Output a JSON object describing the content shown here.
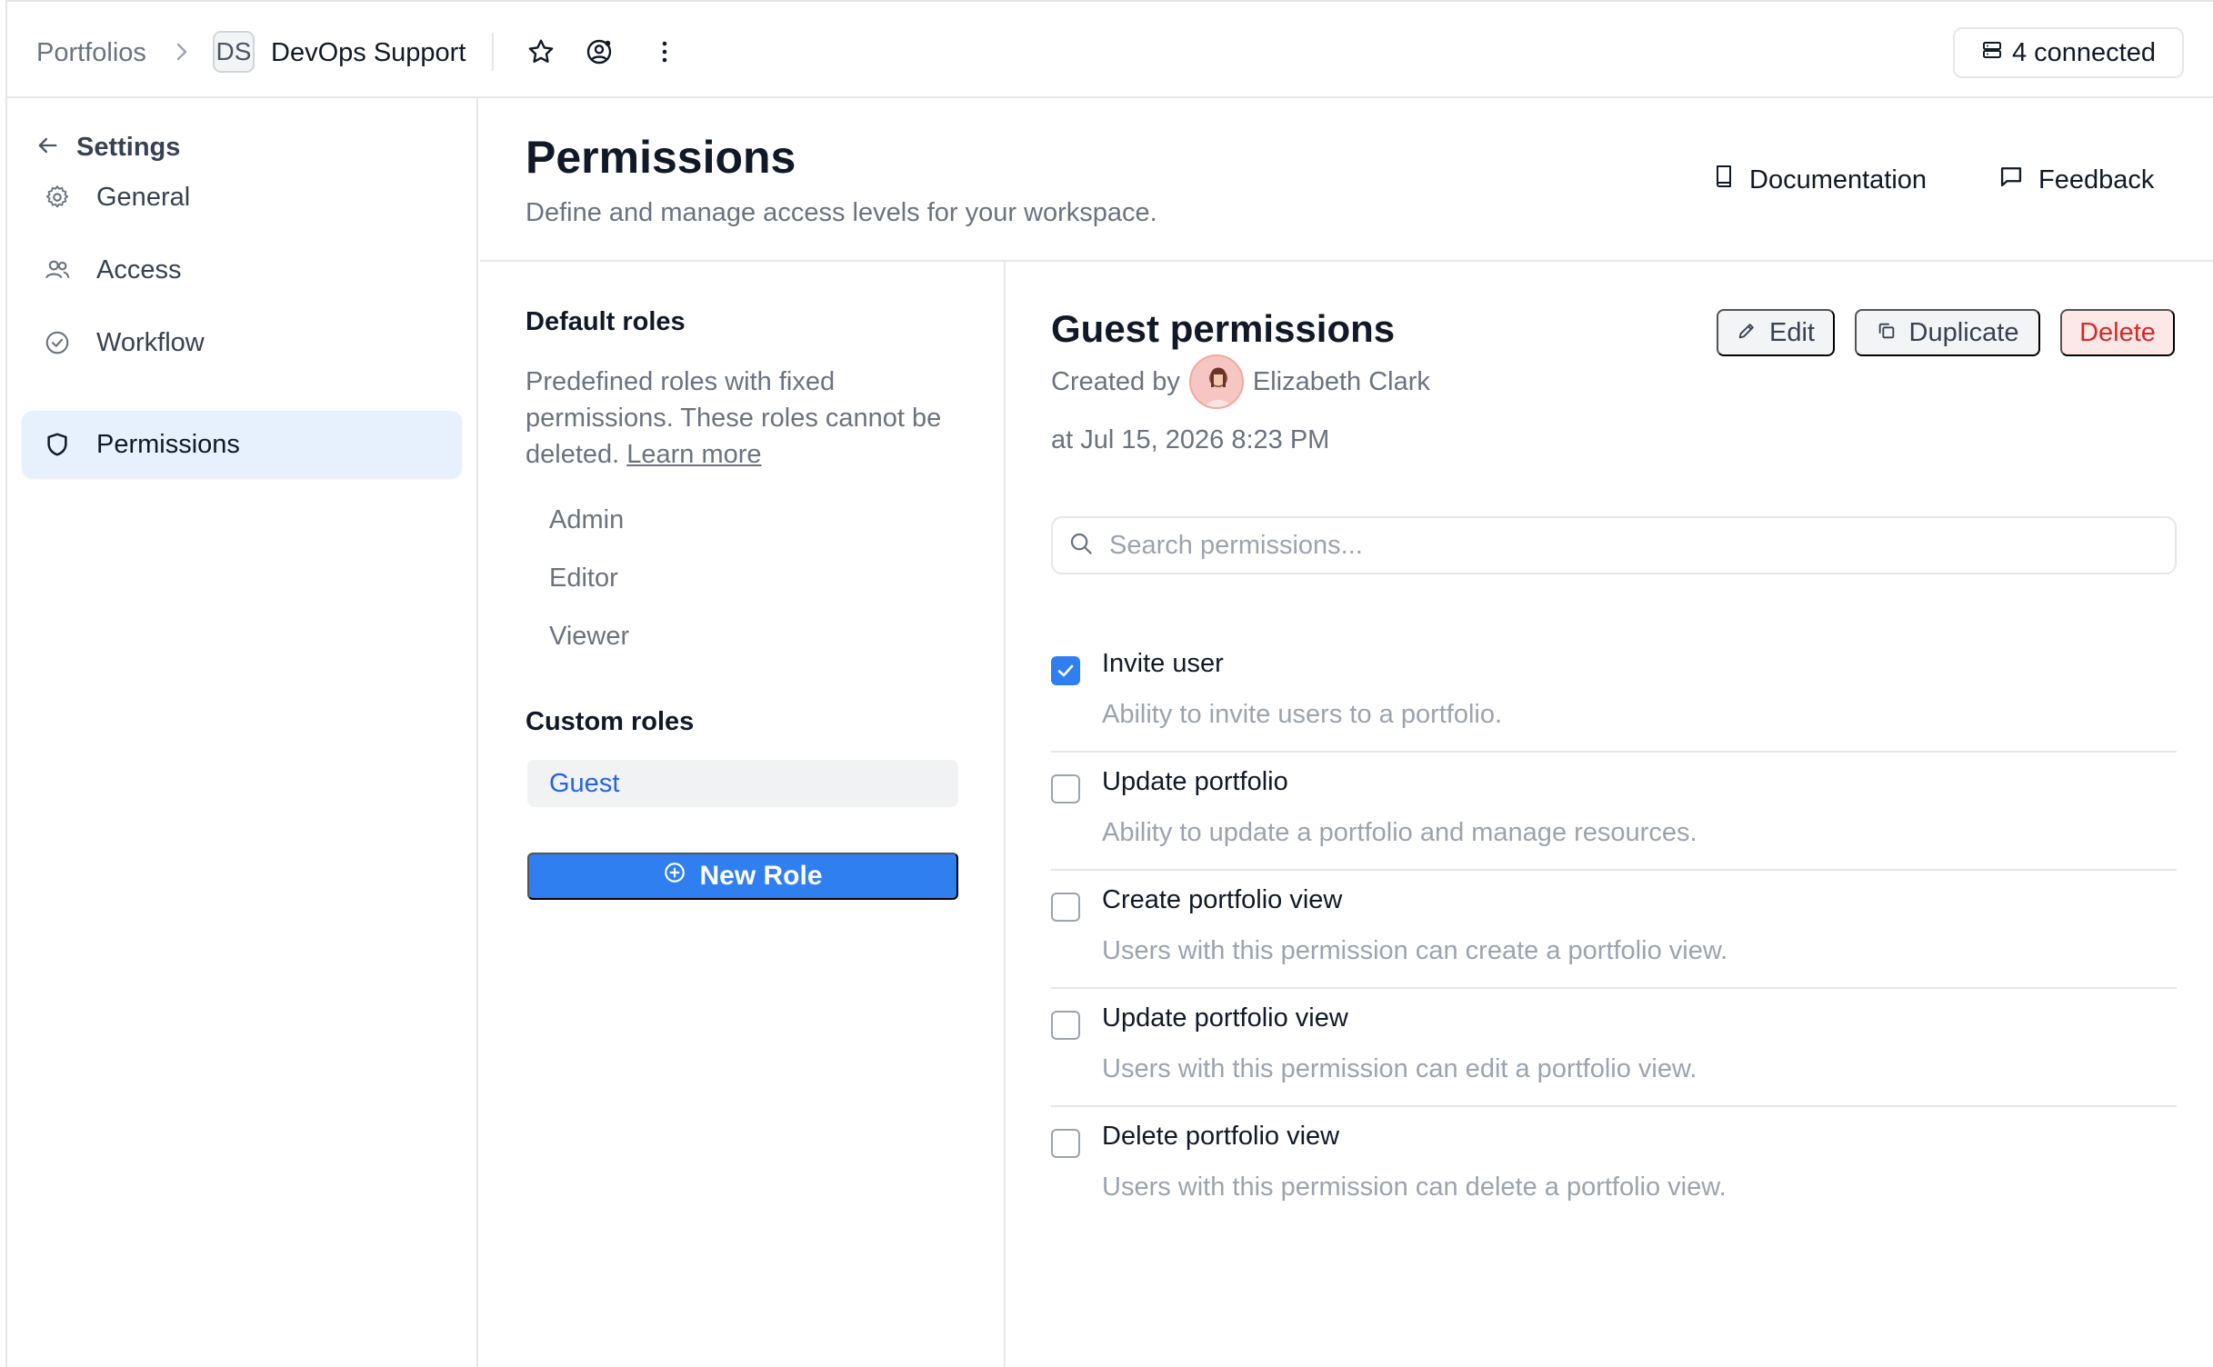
{
  "header": {
    "breadcrumb_root": "Portfolios",
    "workspace_badge": "DS",
    "workspace_name": "DevOps Support",
    "connected_label": "4 connected"
  },
  "sidebar": {
    "back_label": "Settings",
    "items": [
      {
        "label": "General",
        "icon": "gear-icon"
      },
      {
        "label": "Access",
        "icon": "users-icon"
      },
      {
        "label": "Workflow",
        "icon": "check-circle-icon"
      },
      {
        "label": "Permissions",
        "icon": "shield-icon",
        "active": true
      }
    ]
  },
  "main": {
    "title": "Permissions",
    "subtitle": "Define and manage access levels for your workspace.",
    "documentation_label": "Documentation",
    "feedback_label": "Feedback"
  },
  "roles": {
    "default_title": "Default roles",
    "default_desc": "Predefined roles with fixed permissions. These roles cannot be deleted.",
    "learn_more": "Learn more",
    "default_items": [
      "Admin",
      "Editor",
      "Viewer"
    ],
    "custom_title": "Custom roles",
    "custom_items": [
      "Guest"
    ],
    "new_role_label": "New Role"
  },
  "detail": {
    "title": "Guest permissions",
    "created_by_label": "Created by",
    "created_by_name": "Elizabeth Clark",
    "created_at": "at Jul 15, 2026 8:23 PM",
    "edit_label": "Edit",
    "duplicate_label": "Duplicate",
    "delete_label": "Delete",
    "search_placeholder": "Search permissions...",
    "permissions": [
      {
        "name": "Invite user",
        "desc": "Ability to invite users to a portfolio.",
        "checked": true
      },
      {
        "name": "Update portfolio",
        "desc": "Ability to update a portfolio and manage resources.",
        "checked": false
      },
      {
        "name": "Create portfolio view",
        "desc": "Users with this permission can create a portfolio view.",
        "checked": false
      },
      {
        "name": "Update portfolio view",
        "desc": "Users with this permission can edit a portfolio view.",
        "checked": false
      },
      {
        "name": "Delete portfolio view",
        "desc": "Users with this permission can delete a portfolio view.",
        "checked": false
      }
    ]
  },
  "colors": {
    "accent": "#2f7ff1",
    "active_nav_bg": "#e6f1fd",
    "delete_text": "#dc2626",
    "delete_bg": "#fde8e8"
  }
}
